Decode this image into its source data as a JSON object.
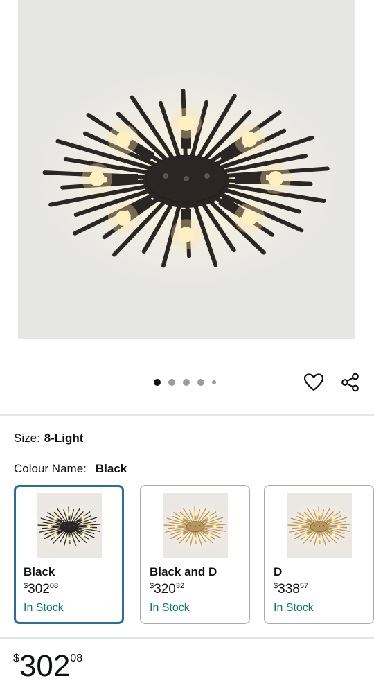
{
  "product": {
    "image_alt": "Sputnik ceiling light fixture in black",
    "carousel": {
      "total_dots": 5,
      "active_index": 0
    }
  },
  "actions": {
    "wishlist_icon": "heart-icon",
    "share_icon": "share-icon"
  },
  "size": {
    "label": "Size:",
    "value": "8-Light"
  },
  "colour": {
    "label": "Colour Name:",
    "value": "Black"
  },
  "swatches": [
    {
      "name": "Black",
      "price_currency": "$",
      "price_whole": "302",
      "price_fraction": "08",
      "stock": "In Stock",
      "selected": true,
      "finish": "black"
    },
    {
      "name": "Black and D",
      "price_currency": "$",
      "price_whole": "320",
      "price_fraction": "32",
      "stock": "In Stock",
      "selected": false,
      "finish": "gold"
    },
    {
      "name": "D",
      "price_currency": "$",
      "price_whole": "338",
      "price_fraction": "57",
      "stock": "In Stock",
      "selected": false,
      "finish": "gold"
    }
  ],
  "price": {
    "currency": "$",
    "whole": "302",
    "fraction": "08"
  },
  "colors": {
    "selected_border": "#2a6f97",
    "in_stock": "#067d62",
    "divider": "#e3e6e6",
    "fixture_black": "#2b2624",
    "fixture_gold": "#b8955a"
  }
}
